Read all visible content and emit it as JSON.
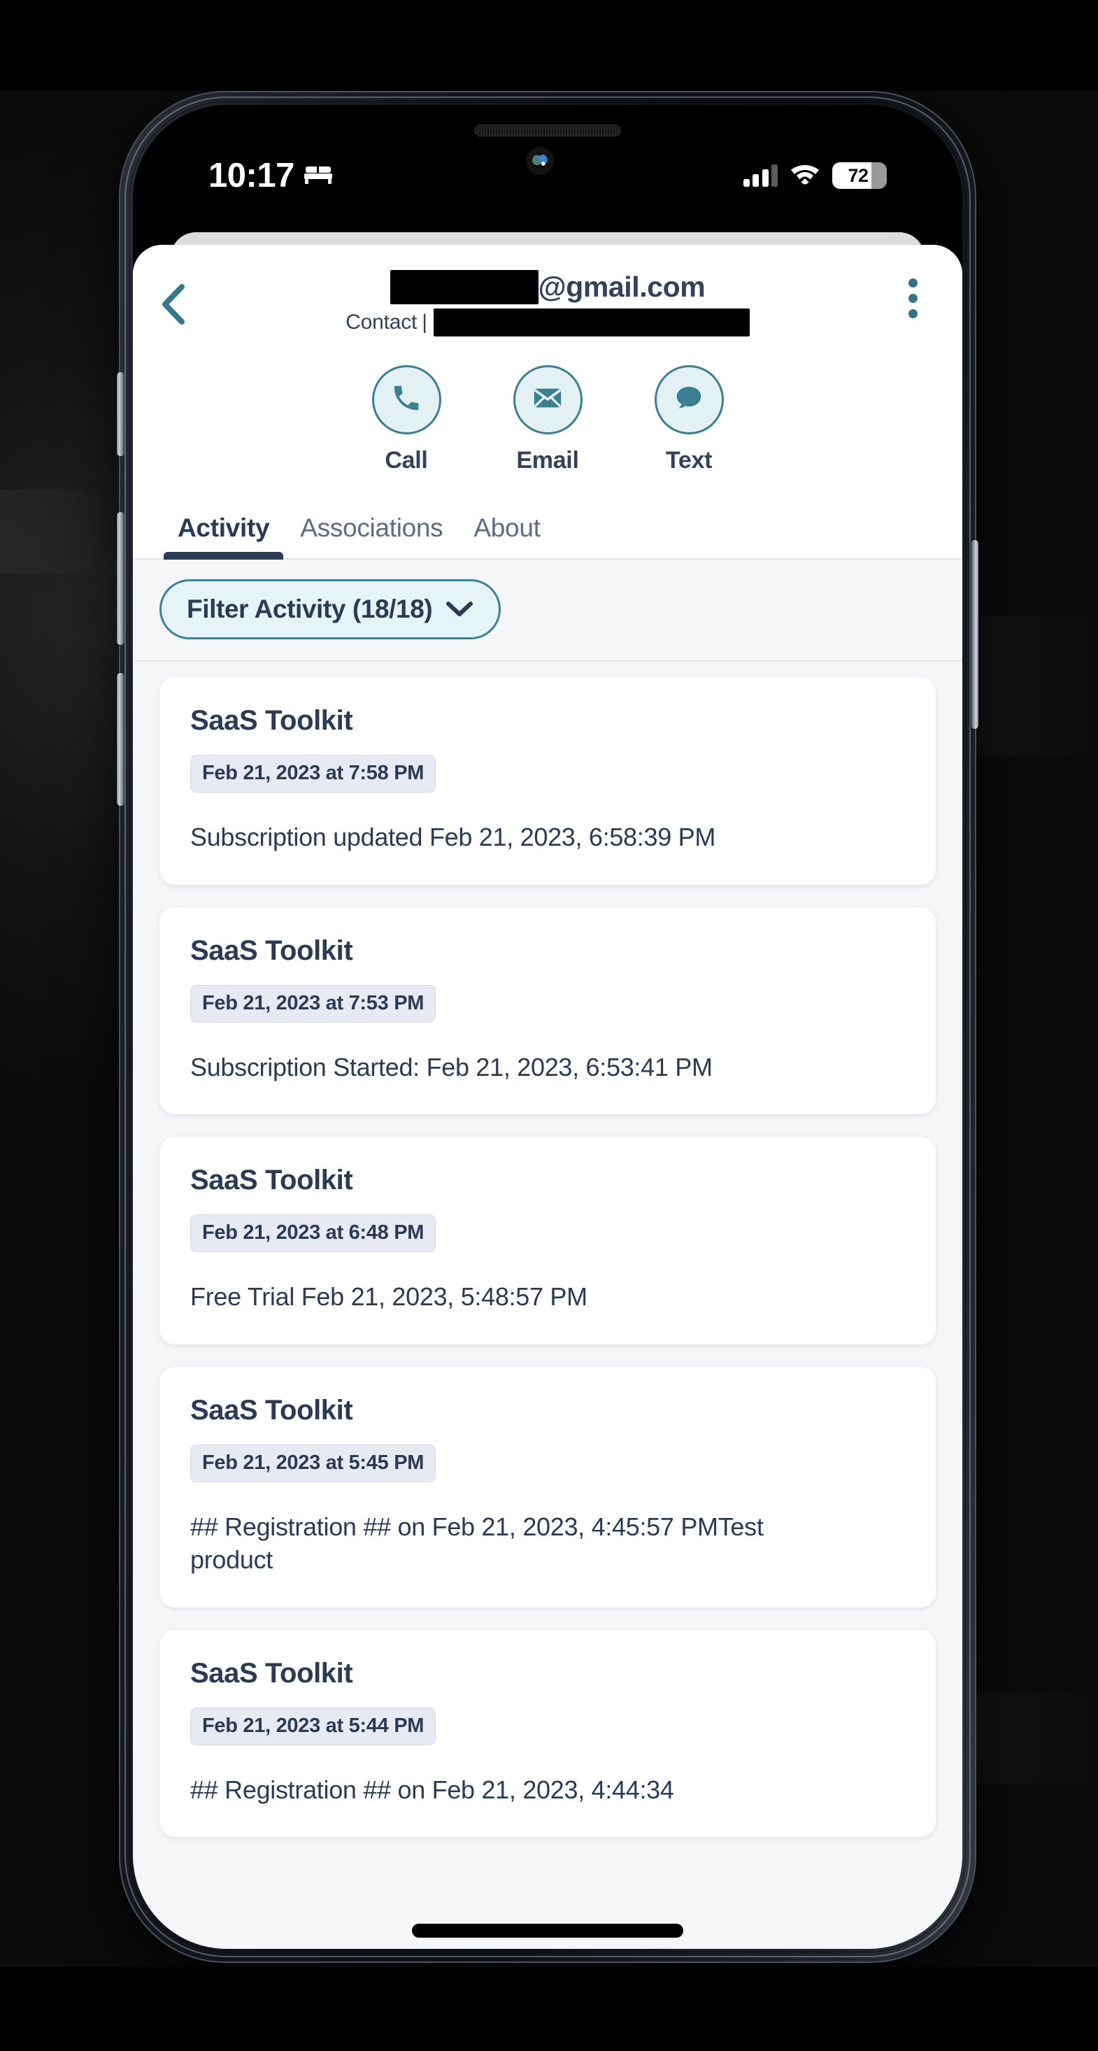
{
  "status_bar": {
    "time": "10:17",
    "focus_icon": "bed-icon",
    "signal_icon": "cellular-signal-icon",
    "signal_bars_filled": 3,
    "signal_bars_total": 4,
    "wifi_icon": "wifi-icon",
    "battery_icon": "battery-icon",
    "battery_percent": "72"
  },
  "header": {
    "back_icon": "chevron-left-icon",
    "email_suffix": "@gmail.com",
    "email_redacted": true,
    "subtitle_label": "Contact",
    "subtitle_divider": "|",
    "subtitle_redacted": true,
    "menu_icon": "kebab-menu-icon"
  },
  "actions": [
    {
      "label": "Call",
      "icon": "phone-icon"
    },
    {
      "label": "Email",
      "icon": "envelope-icon"
    },
    {
      "label": "Text",
      "icon": "chat-bubble-icon"
    }
  ],
  "tabs": [
    {
      "label": "Activity",
      "active": true
    },
    {
      "label": "Associations",
      "active": false
    },
    {
      "label": "About",
      "active": false
    }
  ],
  "filter": {
    "label": "Filter Activity (18/18)",
    "chevron_icon": "chevron-down-icon"
  },
  "activity": [
    {
      "title": "SaaS Toolkit",
      "timestamp": "Feb 21, 2023 at 7:58 PM",
      "body": "Subscription updated Feb 21, 2023, 6:58:39 PM"
    },
    {
      "title": "SaaS Toolkit",
      "timestamp": "Feb 21, 2023 at 7:53 PM",
      "body": "Subscription Started: Feb 21, 2023, 6:53:41 PM"
    },
    {
      "title": "SaaS Toolkit",
      "timestamp": "Feb 21, 2023 at 6:48 PM",
      "body": "Free Trial Feb 21, 2023, 5:48:57 PM"
    },
    {
      "title": "SaaS Toolkit",
      "timestamp": "Feb 21, 2023 at 5:45 PM",
      "body": "## Registration ## on Feb 21, 2023, 4:45:57 PMTest product"
    },
    {
      "title": "SaaS Toolkit",
      "timestamp": "Feb 21, 2023 at 5:44 PM",
      "body": "## Registration ## on Feb 21, 2023, 4:44:34"
    }
  ],
  "colors": {
    "accent_teal": "#3b7f92",
    "text_navy": "#2b3a55",
    "page_bg": "#f4f6f7",
    "card_bg": "#ffffff",
    "badge_bg": "#e7eaf2",
    "pill_bg": "#e6f4f8"
  }
}
